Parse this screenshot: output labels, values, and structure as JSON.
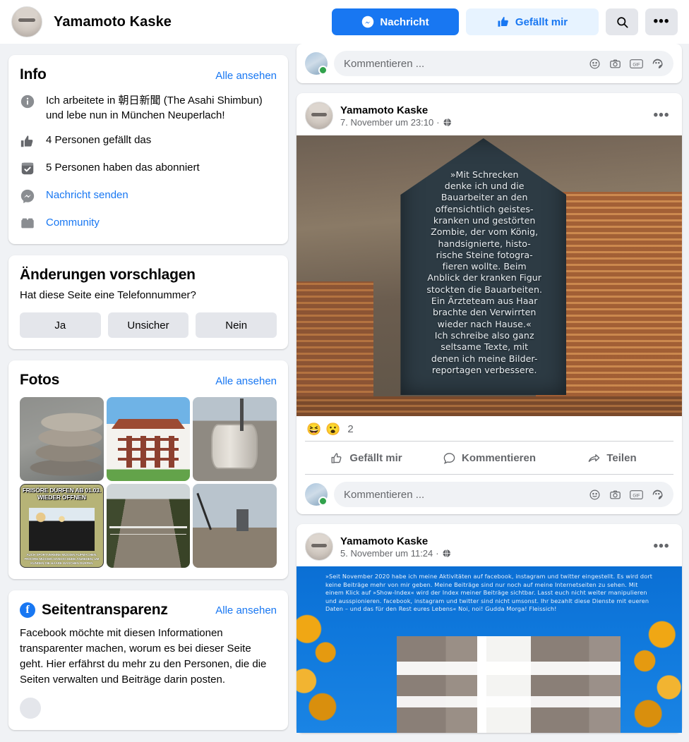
{
  "header": {
    "page_name": "Yamamoto Kaske",
    "message_button": "Nachricht",
    "like_button": "Gefällt mir",
    "search_icon": "search-icon",
    "more_icon": "ellipsis-icon"
  },
  "sidebar": {
    "info": {
      "title": "Info",
      "see_all": "Alle ansehen",
      "rows": [
        {
          "icon": "info-circle-icon",
          "text": "Ich arbeitete in 朝日新聞 (The Asahi Shimbun) und lebe nun in München Neuperlach!",
          "link": false
        },
        {
          "icon": "thumbs-up-icon",
          "text": "4 Personen gefällt das",
          "link": false
        },
        {
          "icon": "check-badge-icon",
          "text": "5 Personen haben das abonniert",
          "link": false
        },
        {
          "icon": "messenger-icon",
          "text": "Nachricht senden",
          "link": true
        },
        {
          "icon": "community-icon",
          "text": "Community",
          "link": true
        }
      ]
    },
    "suggest_edits": {
      "title": "Änderungen vorschlagen",
      "question": "Hat diese Seite eine Telefonnummer?",
      "buttons": [
        "Ja",
        "Unsicher",
        "Nein"
      ]
    },
    "photos": {
      "title": "Fotos",
      "see_all": "Alle ansehen",
      "items": [
        {
          "alt": "Gestapelte Steine"
        },
        {
          "alt": "Wohnhaus mit rotem Dach"
        },
        {
          "alt": "Betonring auf Baustelle"
        },
        {
          "alt": "Plakat Frisöre dürfen ab 01.03. wieder öffnen",
          "top_text": "FRISÖRE DÜRFEN AB 01.03. WIEDER ÖFFNEN",
          "bottom_text": "AUCH SPORTVEREINE MÜSSEN AUFMACHEN. FRISÖRE MÜSSEN HANDSCHUHE ANZIEHEN, UM KUNDEN DIE HAARE WASCHEN DÜRFEN"
        },
        {
          "alt": "Feldweg mit Geländer"
        },
        {
          "alt": "Baukran auf Baustelle"
        }
      ]
    },
    "transparency": {
      "icon": "facebook-logo-icon",
      "title": "Seitentransparenz",
      "see_all": "Alle ansehen",
      "body": "Facebook möchte mit diesen Informationen transparenter machen, worum es bei dieser Seite geht. Hier erfährst du mehr zu den Personen, die die Seiten verwalten und Beiträge darin posten."
    }
  },
  "feed": {
    "top_comment_bar": {
      "placeholder": "Kommentieren ...",
      "icons": [
        "emoji-icon",
        "camera-icon",
        "gif-icon",
        "sticker-icon"
      ]
    },
    "posts": [
      {
        "author": "Yamamoto Kaske",
        "timestamp": "7. November um 23:10",
        "privacy_icon": "globe-icon",
        "more_icon": "ellipsis-icon",
        "image": {
          "type": "brick-wall-arch",
          "overlay_text": "»Mit Schrecken\ndenke ich und die\nBauarbeiter an den\noffensichtlich geistes-\nkranken und gestörten\nZombie, der vom König,\nhandsignierte, histo-\nrische Steine fotogra-\nfieren wollte. Beim\nAnblick der kranken Figur\nstockten die Bauarbeiten.\nEin Ärzteteam aus Haar\nbrachte den Verwirrten\nwieder nach Hause.«\nIch schreibe also ganz\nseltsame Texte, mit\ndenen ich meine Bilder-\nreportagen verbessere."
        },
        "reactions": {
          "emojis": [
            "😆",
            "😮"
          ],
          "count": "2"
        },
        "actions": [
          {
            "icon": "thumbs-up-outline-icon",
            "label": "Gefällt mir"
          },
          {
            "icon": "comment-bubble-icon",
            "label": "Kommentieren"
          },
          {
            "icon": "share-arrow-icon",
            "label": "Teilen"
          }
        ],
        "comment_bar": {
          "placeholder": "Kommentieren ...",
          "icons": [
            "emoji-icon",
            "camera-icon",
            "gif-icon",
            "sticker-icon"
          ]
        }
      },
      {
        "author": "Yamamoto Kaske",
        "timestamp": "5. November um 11:24",
        "privacy_icon": "globe-icon",
        "more_icon": "ellipsis-icon",
        "image": {
          "type": "blue-sky-building",
          "overlay_text": "»Seit November 2020 habe ich meine Aktivitäten auf facebook, instagram und twitter eingestellt. Es wird dort keine Beiträge mehr von mir geben. Meine Beiträge sind nur noch auf meine Internetseiten zu sehen. Mit einem Klick auf »Show-Index« wird der Index meiner Beiträge sichtbar. Lasst euch nicht weiter manipulieren und ausspionieren. facebook, instagram und twitter sind nicht umsonst. Ihr bezahlt diese Dienste mit eueren Daten – und das für den Rest eures Lebens« Noi, noi! Gudda Morga! Fleissich!"
        }
      }
    ]
  },
  "colors": {
    "brand_blue": "#1877f2",
    "light_blue": "#e7f3ff",
    "page_bg": "#f0f2f5",
    "card_bg": "#ffffff",
    "secondary_text": "#65676b",
    "button_grey": "#e4e6eb",
    "online_green": "#31a24c"
  }
}
